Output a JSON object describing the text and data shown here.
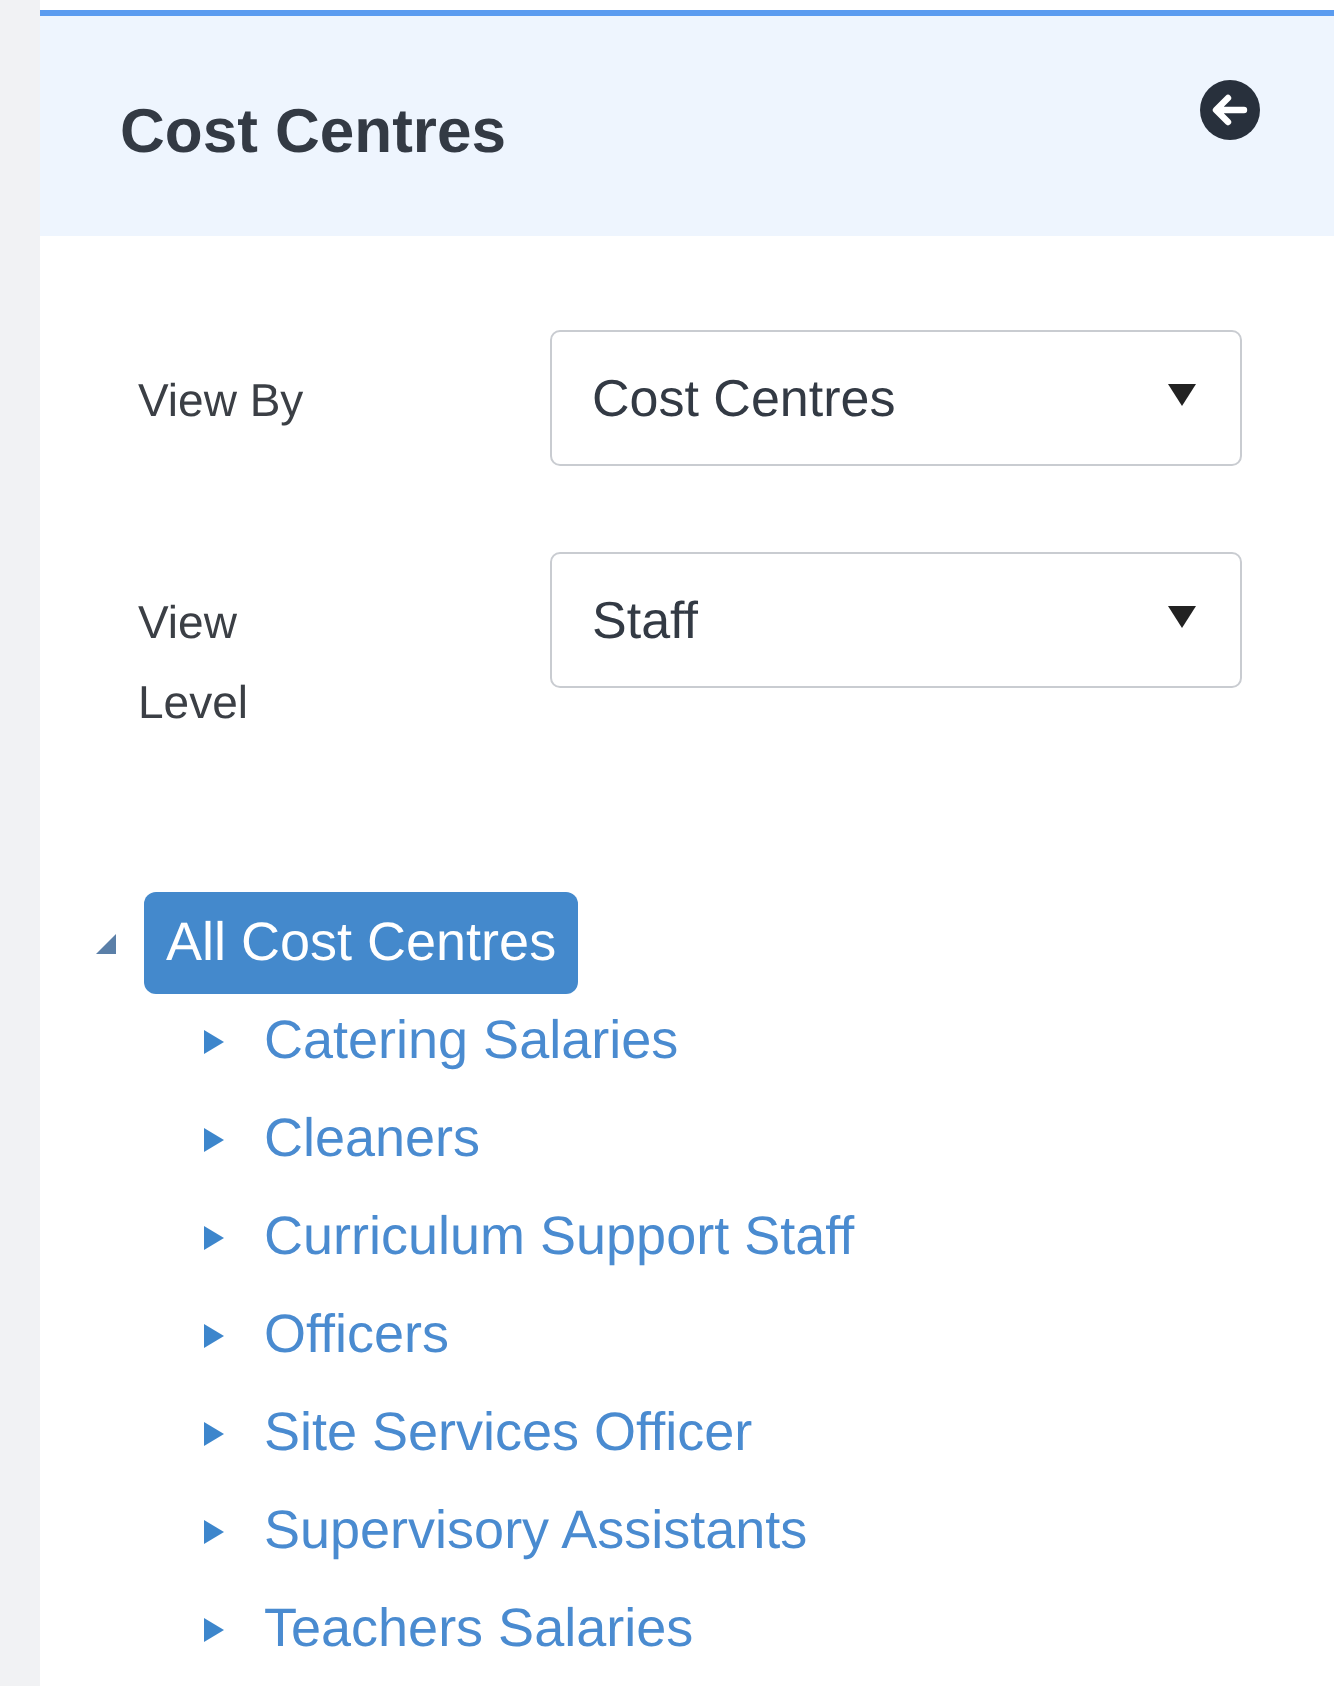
{
  "panel": {
    "title": "Cost Centres"
  },
  "filters": [
    {
      "label": "View By",
      "value": "Cost Centres"
    },
    {
      "label": "View Level",
      "value": "Staff"
    }
  ],
  "tree": [
    {
      "label": "All Cost Centres",
      "expanded": true,
      "selected": true,
      "children": [
        {
          "label": "Catering Salaries",
          "expanded": false,
          "selected": false
        },
        {
          "label": "Cleaners",
          "expanded": false,
          "selected": false
        },
        {
          "label": "Curriculum Support Staff",
          "expanded": false,
          "selected": false
        },
        {
          "label": "Officers",
          "expanded": false,
          "selected": false
        },
        {
          "label": "Site Services Officer",
          "expanded": false,
          "selected": false
        },
        {
          "label": "Supervisory Assistants",
          "expanded": false,
          "selected": false
        },
        {
          "label": "Teachers Salaries",
          "expanded": false,
          "selected": false
        }
      ]
    }
  ]
}
